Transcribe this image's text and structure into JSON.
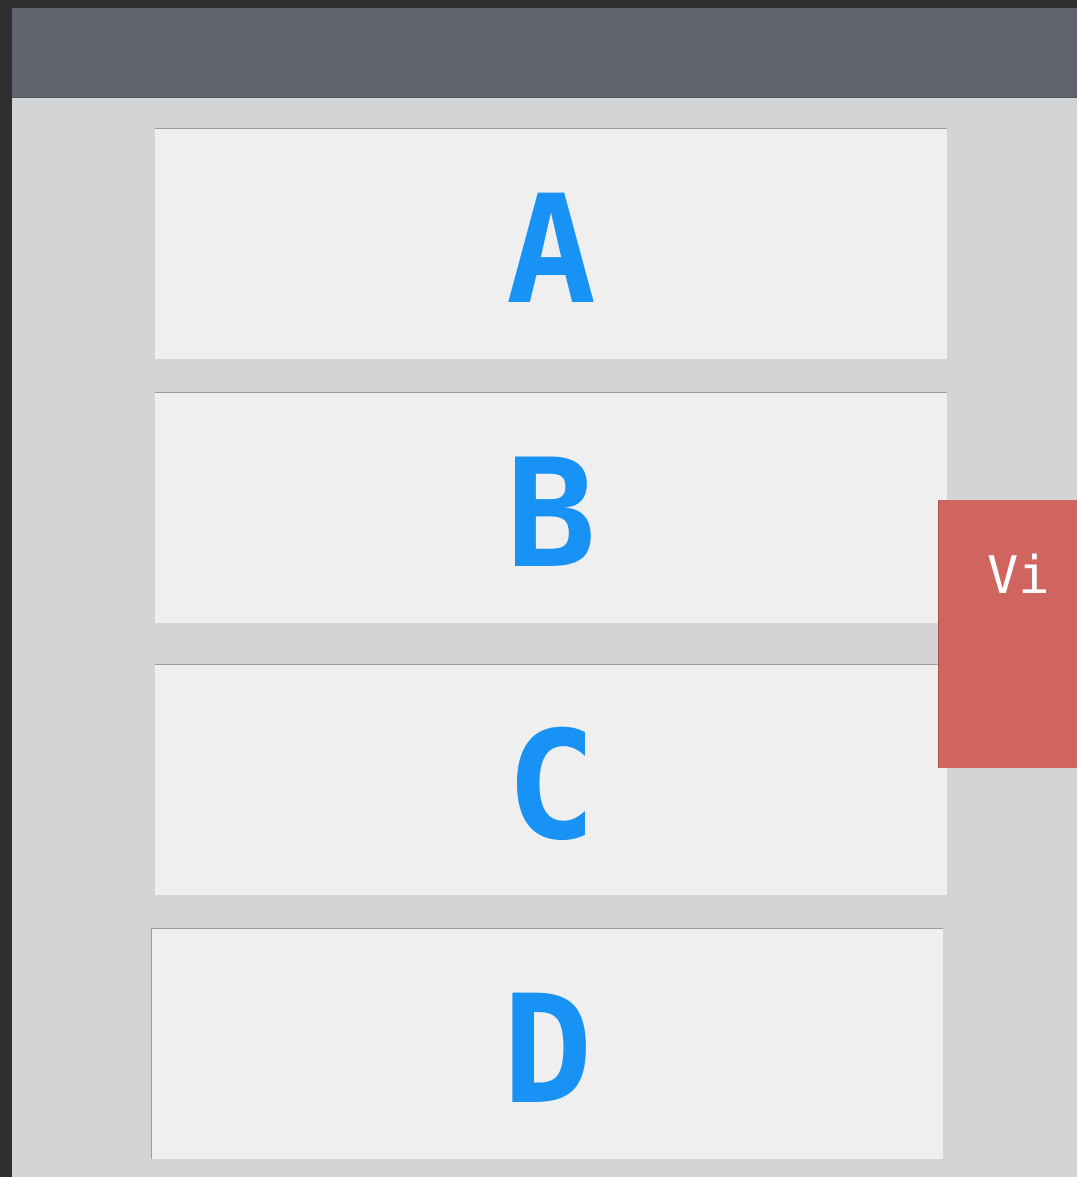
{
  "options": [
    {
      "label": "A"
    },
    {
      "label": "B"
    },
    {
      "label": "C"
    },
    {
      "label": "D"
    }
  ],
  "side_panel": {
    "label": "Vi"
  },
  "colors": {
    "background_outer": "#2f2f2f",
    "content_background": "#d3d4d6",
    "top_bar": "#5f636d",
    "card_background": "#efefef",
    "letter_color": "#1893f5",
    "side_panel_color": "#d0645e",
    "side_panel_text": "#ffffff"
  }
}
